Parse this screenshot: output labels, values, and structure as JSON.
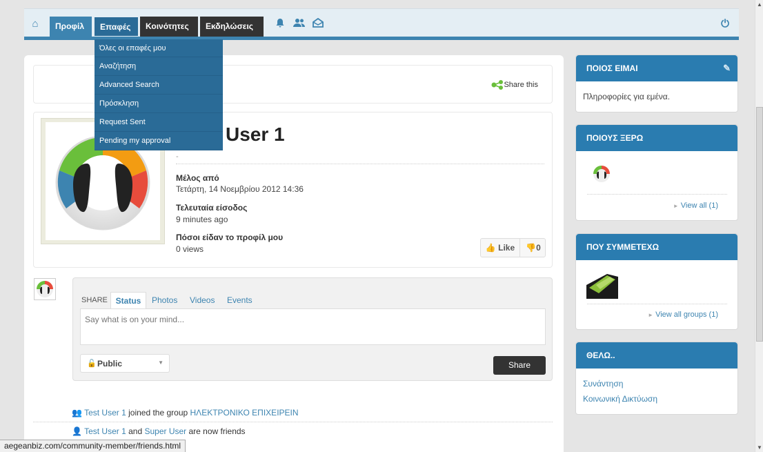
{
  "nav": {
    "tabs": [
      "Προφίλ",
      "Επαφές",
      "Κοινότητες",
      "Εκδηλώσεις"
    ],
    "icons": [
      "home-icon",
      "bell-icon",
      "users-icon",
      "inbox-icon",
      "power-icon"
    ]
  },
  "dropdown": {
    "items": [
      "Όλες οι επαφές μου",
      "Αναζήτηση",
      "Advanced Search",
      "Πρόσκληση",
      "Request Sent",
      "Pending my approval"
    ]
  },
  "share_this": "Share this",
  "profile": {
    "name": "User 1",
    "dash": "-",
    "member_since_label": "Μέλος από",
    "member_since": "Τετάρτη, 14 Νοεμβρίου 2012 14:36",
    "last_login_label": "Τελευταία είσοδος",
    "last_login": "9 minutes ago",
    "views_label": "Πόσοι είδαν το προφίλ μου",
    "views": "0 views",
    "like_label": "Like",
    "dislike_count": "0"
  },
  "composer": {
    "share_label": "SHARE",
    "tabs": [
      "Status",
      "Photos",
      "Videos",
      "Events"
    ],
    "placeholder": "Say what is on your mind...",
    "privacy": "Public",
    "share_button": "Share"
  },
  "activity": [
    {
      "user": "Test User 1",
      "text": " joined the group ",
      "target": "ΗΛΕΚΤΡΟΝΙΚΟ ΕΠΙΧΕΙΡΕΙΝ"
    },
    {
      "user": "Test User 1",
      "text": " and ",
      "target": "Super User",
      "suffix": " are now friends"
    }
  ],
  "widgets": {
    "about": {
      "title": "ΠΟΙΟΣ ΕΙΜΑΙ",
      "body": "Πληροφορίες για εμένα."
    },
    "friends": {
      "title": "ΠΟΙΟΥΣ ΞΕΡΩ",
      "view_all": "View all (1)"
    },
    "groups": {
      "title": "ΠΟΥ ΣΥΜΜΕΤΕΧΩ",
      "view_all": "View all groups (1)"
    },
    "want": {
      "title": "ΘΕΛΩ..",
      "links": [
        "Συνάντηση",
        "Κοινωνική Δικτύωση"
      ]
    }
  },
  "status_bar": "aegeanbiz.com/community-member/friends.html",
  "colors": {
    "brand_blue": "#3d84b0",
    "dark_tab": "#333333",
    "header_blue": "#2a7cb0"
  }
}
